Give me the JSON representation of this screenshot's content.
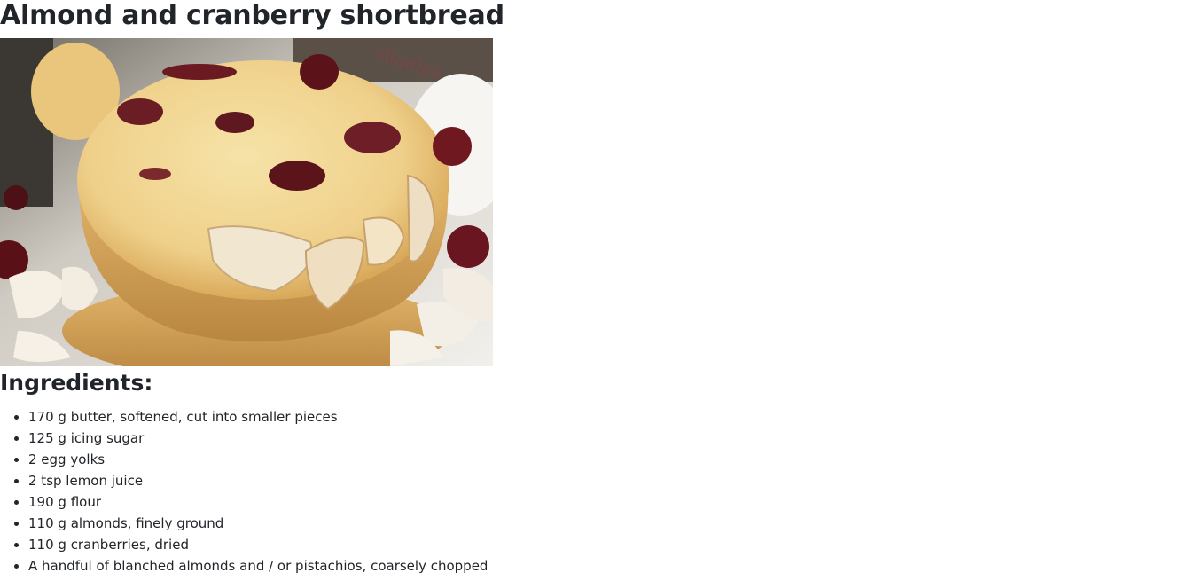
{
  "recipe": {
    "title": "Almond and cranberry shortbread",
    "image_alt": "Almond and cranberry shortbread",
    "ingredients_heading": "Ingredients:",
    "ingredients": [
      "170 g butter, softened, cut into smaller pieces",
      "125 g icing sugar",
      "2 egg yolks",
      "2 tsp lemon juice",
      "190 g flour",
      "110 g almonds, finely ground",
      "110 g cranberries, dried",
      "A handful of blanched almonds and / or pistachios, coarsely chopped"
    ]
  }
}
